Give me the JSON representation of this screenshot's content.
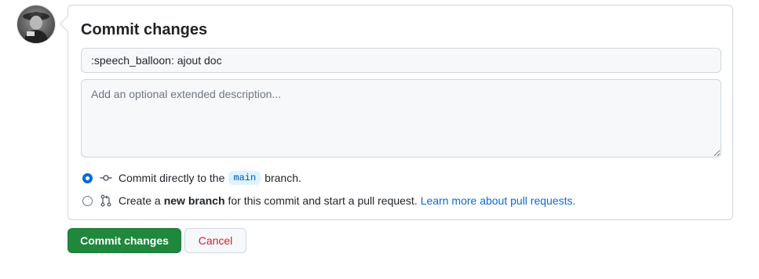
{
  "form": {
    "title": "Commit changes",
    "summary_value": ":speech_balloon: ajout doc",
    "description_value": "",
    "description_placeholder": "Add an optional extended description..."
  },
  "options": {
    "direct": {
      "prefix": "Commit directly to the",
      "branch": "main",
      "suffix": "branch.",
      "selected": true,
      "icon": "git-commit-icon"
    },
    "new_branch": {
      "prefix": "Create a",
      "bold": "new branch",
      "suffix": "for this commit and start a pull request.",
      "link": "Learn more about pull requests.",
      "selected": false,
      "icon": "git-pull-request-icon"
    }
  },
  "actions": {
    "commit_label": "Commit changes",
    "cancel_label": "Cancel"
  },
  "colors": {
    "primary": "#1f883d",
    "link": "#0969da",
    "danger": "#cf222e",
    "chip_bg": "#ddf4ff"
  }
}
